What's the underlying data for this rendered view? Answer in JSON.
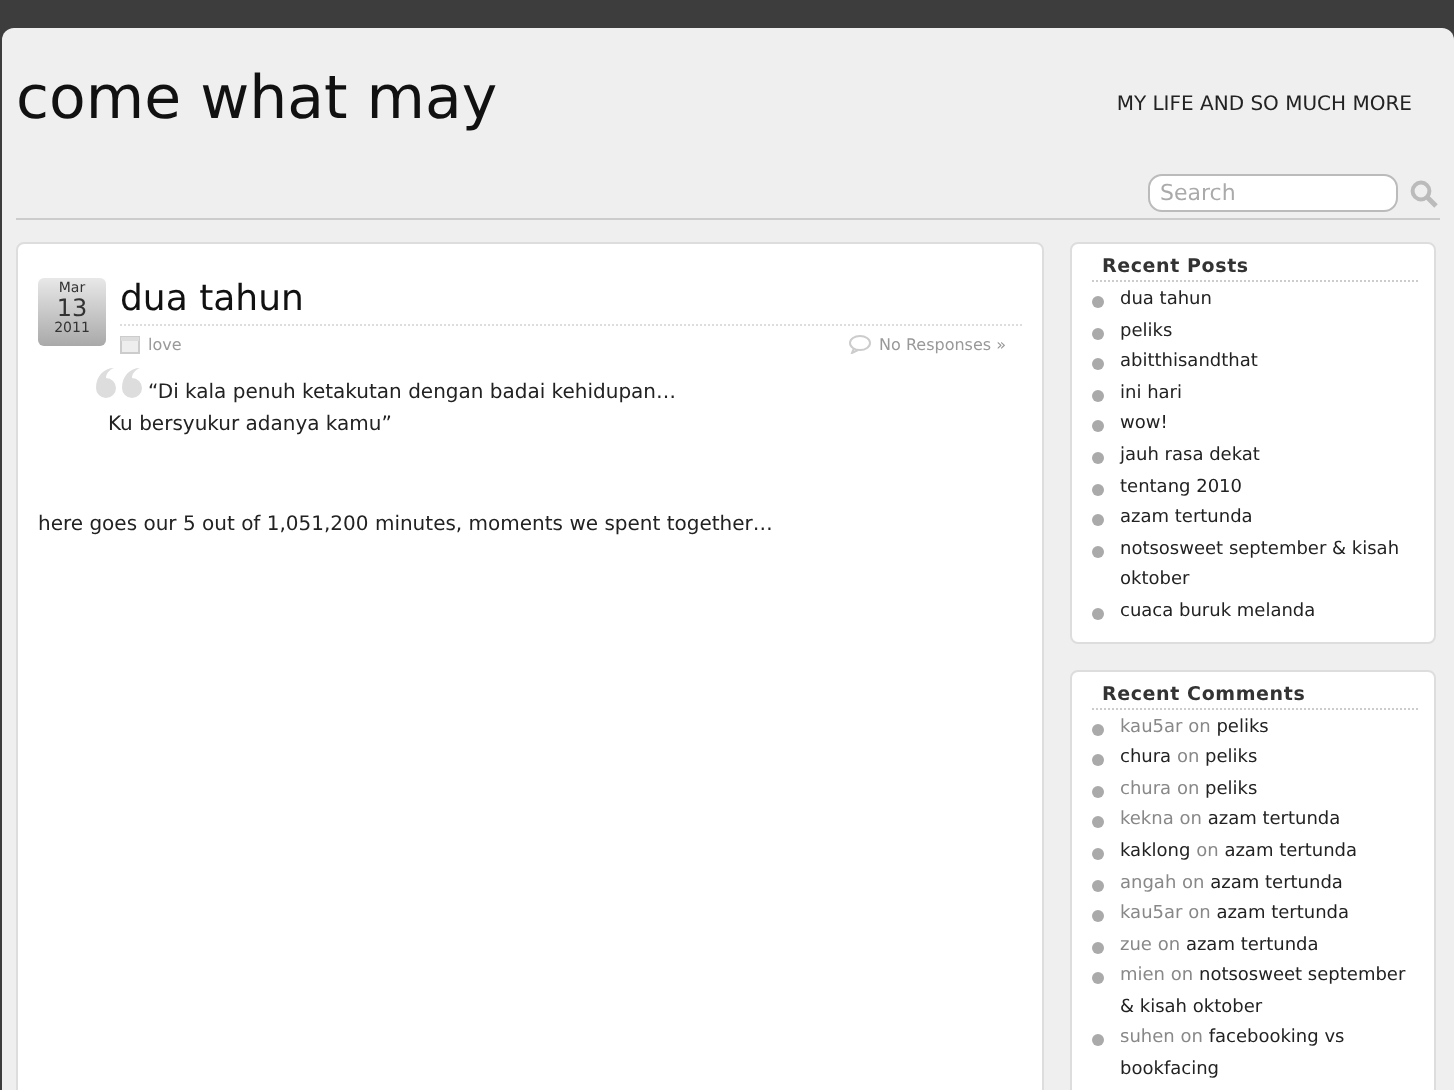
{
  "site": {
    "title": "come what may",
    "tagline": "MY LIFE AND SO MUCH MORE"
  },
  "search": {
    "placeholder": "Search"
  },
  "post": {
    "date": {
      "month": "Mar",
      "day": "13",
      "year": "2011"
    },
    "title": "dua tahun",
    "category": "love",
    "responses": "No Responses »",
    "quote": [
      "“Di kala penuh ketakutan dengan badai kehidupan…",
      "Ku bersyukur adanya kamu”"
    ],
    "body": "here goes our 5 out of 1,051,200 minutes, moments we spent together…"
  },
  "recent_posts": {
    "title": "Recent Posts",
    "items": [
      "dua tahun",
      "peliks",
      "abitthisandthat",
      "ini hari",
      "wow!",
      "jauh rasa dekat",
      "tentang 2010",
      "azam tertunda",
      "notsosweet september & kisah oktober",
      "cuaca buruk melanda"
    ]
  },
  "recent_comments": {
    "title": "Recent Comments",
    "items": [
      {
        "author": "kau5ar",
        "linked": false,
        "joiner": "on",
        "post": "peliks"
      },
      {
        "author": "chura",
        "linked": true,
        "joiner": "on",
        "post": "peliks"
      },
      {
        "author": "chura",
        "linked": false,
        "joiner": "on",
        "post": "peliks"
      },
      {
        "author": "kekna",
        "linked": false,
        "joiner": "on",
        "post": "azam tertunda"
      },
      {
        "author": "kaklong",
        "linked": true,
        "joiner": "on",
        "post": "azam tertunda"
      },
      {
        "author": "angah",
        "linked": false,
        "joiner": "on",
        "post": "azam tertunda"
      },
      {
        "author": "kau5ar",
        "linked": false,
        "joiner": "on",
        "post": "azam tertunda"
      },
      {
        "author": "zue",
        "linked": false,
        "joiner": "on",
        "post": "azam tertunda"
      },
      {
        "author": "mien",
        "linked": false,
        "joiner": "on",
        "post": "notsosweet september & kisah oktober"
      },
      {
        "author": "suhen",
        "linked": false,
        "joiner": "on",
        "post": "facebooking vs bookfacing"
      }
    ]
  }
}
